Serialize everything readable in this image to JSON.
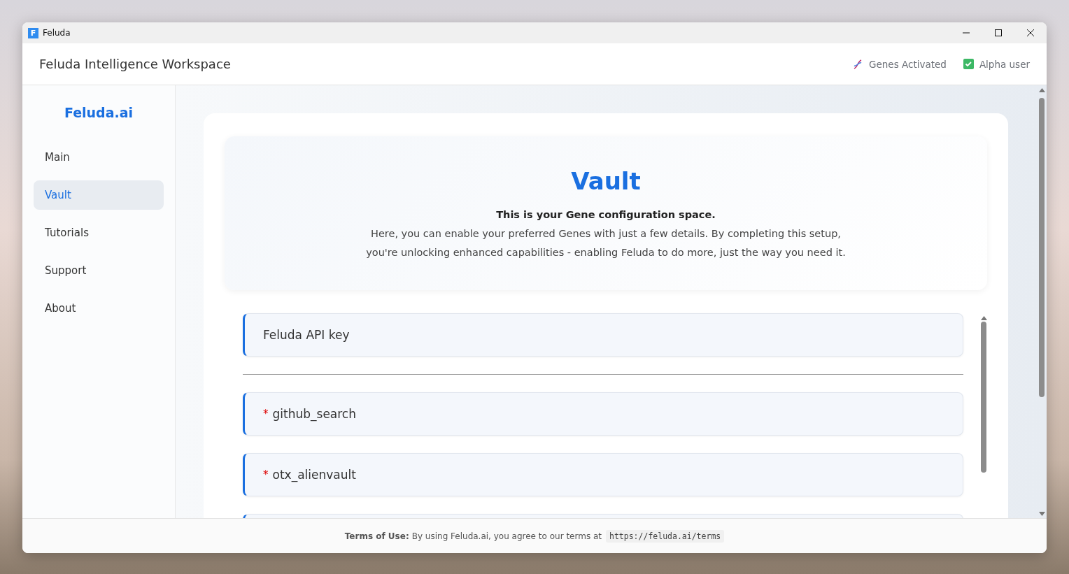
{
  "window": {
    "logo": "F",
    "title": "Feluda"
  },
  "header": {
    "title": "Feluda Intelligence Workspace",
    "badges": [
      {
        "kind": "dna",
        "label": "Genes Activated"
      },
      {
        "kind": "check",
        "label": "Alpha user"
      }
    ]
  },
  "sidebar": {
    "brand": "Feluda.ai",
    "items": [
      {
        "label": "Main",
        "selected": false
      },
      {
        "label": "Vault",
        "selected": true
      },
      {
        "label": "Tutorials",
        "selected": false
      },
      {
        "label": "Support",
        "selected": false
      },
      {
        "label": "About",
        "selected": false
      }
    ]
  },
  "vault": {
    "title": "Vault",
    "subtitle": "This is your Gene configuration space.",
    "description": "Here, you can enable your preferred Genes with just a few details. By completing this setup, you're unlocking enhanced capabilities - enabling Feluda to do more, just the way you need it."
  },
  "genes": [
    {
      "kind": "api_key",
      "label": "Feluda API key"
    },
    {
      "kind": "gene",
      "required_mark": "*",
      "label": "github_search"
    },
    {
      "kind": "gene",
      "required_mark": "*",
      "label": "otx_alienvault"
    }
  ],
  "footer": {
    "label": "Terms of Use:",
    "text": "By using Feluda.ai, you agree to our terms at",
    "link": "https://feluda.ai/terms"
  }
}
